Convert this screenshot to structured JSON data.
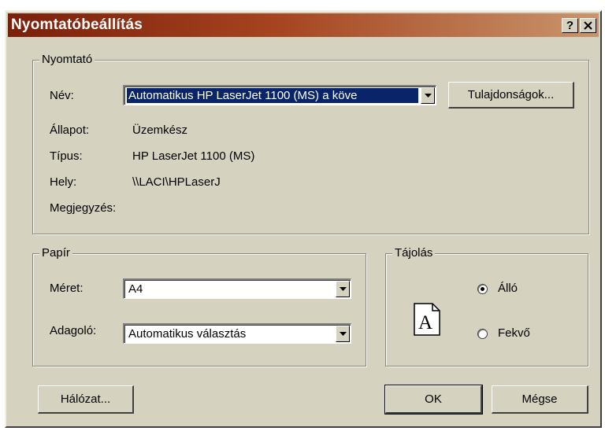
{
  "window": {
    "title": "Nyomtatóbeállítás",
    "help_glyph": "?",
    "close_glyph": "x"
  },
  "printer": {
    "group_label": "Nyomtató",
    "name_label": "Név:",
    "name_value": "Automatikus HP LaserJet 1100 (MS) a köve",
    "properties_button": "Tulajdonságok...",
    "status_label": "Állapot:",
    "status_value": "Üzemkész",
    "type_label": "Típus:",
    "type_value": "HP LaserJet 1100 (MS)",
    "location_label": "Hely:",
    "location_value": "\\\\LACI\\HPLaserJ",
    "comment_label": "Megjegyzés:",
    "comment_value": ""
  },
  "paper": {
    "group_label": "Papír",
    "size_label": "Méret:",
    "size_value": "A4",
    "source_label": "Adagoló:",
    "source_value": "Automatikus választás"
  },
  "orientation": {
    "group_label": "Tájolás",
    "page_icon_letter": "A",
    "portrait_label": "Álló",
    "landscape_label": "Fekvő",
    "selected": "portrait"
  },
  "buttons": {
    "network": "Hálózat...",
    "ok": "OK",
    "cancel": "Mégse"
  },
  "colors": {
    "dialog_face": "#d5d2c0",
    "titlebar_start": "#7a1f0a",
    "titlebar_end": "#c9956c",
    "selection": "#0a246a"
  }
}
